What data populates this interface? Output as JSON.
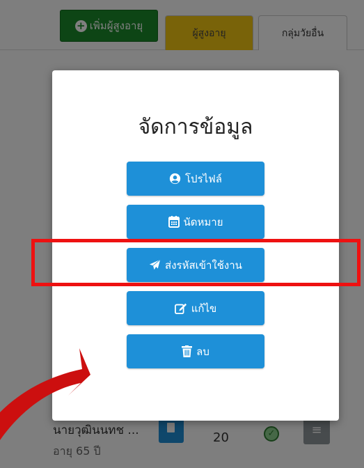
{
  "header": {
    "add_button_label": "เพิ่มผู้สูงอายุ",
    "tabs": [
      {
        "label": "ผู้สูงอายุ",
        "active": true
      },
      {
        "label": "กลุ่มวัยอื่น",
        "active": false
      }
    ]
  },
  "list_row": {
    "name": "นายวุฒินนทช ...",
    "age": "อายุ 65 ปี",
    "count": "20"
  },
  "modal": {
    "title": "จัดการข้อมูล",
    "buttons": [
      {
        "label": "โปรไฟล์",
        "icon": "user-circle-icon"
      },
      {
        "label": "นัดหมาย",
        "icon": "calendar-icon"
      },
      {
        "label": "ส่งรหัสเข้าใช้งาน",
        "icon": "paper-plane-icon"
      },
      {
        "label": "แก้ไข",
        "icon": "edit-icon"
      },
      {
        "label": "ลบ",
        "icon": "trash-icon"
      }
    ]
  },
  "colors": {
    "primary_button": "#1e90d8",
    "add_button": "#1b8a2a",
    "active_tab": "#f3c613",
    "highlight": "#ee1111"
  }
}
